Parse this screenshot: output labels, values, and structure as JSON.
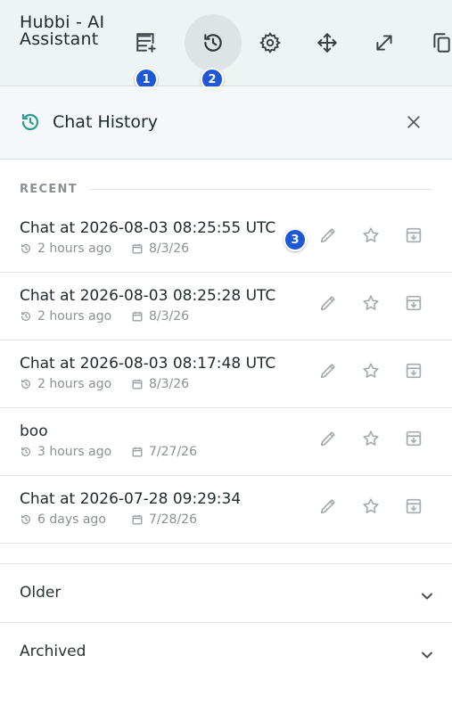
{
  "app": {
    "title": "Hubbi - AI Assistant"
  },
  "toolbar": {
    "buttons": [
      {
        "name": "new-chat",
        "icon": "new-chat-icon"
      },
      {
        "name": "history",
        "icon": "history-icon",
        "active": true
      },
      {
        "name": "settings",
        "icon": "gear-icon"
      },
      {
        "name": "move",
        "icon": "move-icon"
      },
      {
        "name": "expand",
        "icon": "expand-icon"
      },
      {
        "name": "copy",
        "icon": "copy-icon"
      }
    ],
    "badges": [
      "1",
      "2"
    ]
  },
  "history": {
    "title": "Chat History",
    "close_icon": "close-icon"
  },
  "recent": {
    "label": "RECENT",
    "chats": [
      {
        "title": "Chat at 2026-08-03 08:25:55 UTC",
        "age": "2 hours ago",
        "date": "8/3/26"
      },
      {
        "title": "Chat at 2026-08-03 08:25:28 UTC",
        "age": "2 hours ago",
        "date": "8/3/26"
      },
      {
        "title": "Chat at 2026-08-03 08:17:48 UTC",
        "age": "2 hours ago",
        "date": "8/3/26"
      },
      {
        "title": "boo",
        "age": "3 hours ago",
        "date": "7/27/26"
      },
      {
        "title": "Chat at 2026-07-28 09:29:34",
        "age": "6 days ago",
        "date": "7/28/26"
      }
    ],
    "row_badge": "3"
  },
  "sections": {
    "older": "Older",
    "archived": "Archived"
  },
  "colors": {
    "topbar_bg": "#eef3f4",
    "badge": "#1f58d6",
    "history_icon": "#2e9a8f",
    "muted": "#8a9094",
    "action_icon": "#a4abae"
  }
}
